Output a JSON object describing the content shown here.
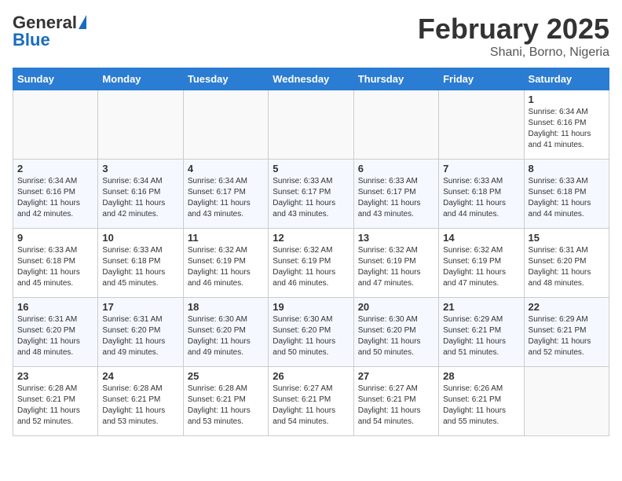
{
  "header": {
    "logo_general": "General",
    "logo_blue": "Blue",
    "title": "February 2025",
    "subtitle": "Shani, Borno, Nigeria"
  },
  "weekdays": [
    "Sunday",
    "Monday",
    "Tuesday",
    "Wednesday",
    "Thursday",
    "Friday",
    "Saturday"
  ],
  "weeks": [
    [
      {
        "day": "",
        "info": ""
      },
      {
        "day": "",
        "info": ""
      },
      {
        "day": "",
        "info": ""
      },
      {
        "day": "",
        "info": ""
      },
      {
        "day": "",
        "info": ""
      },
      {
        "day": "",
        "info": ""
      },
      {
        "day": "1",
        "info": "Sunrise: 6:34 AM\nSunset: 6:16 PM\nDaylight: 11 hours and 41 minutes."
      }
    ],
    [
      {
        "day": "2",
        "info": "Sunrise: 6:34 AM\nSunset: 6:16 PM\nDaylight: 11 hours and 42 minutes."
      },
      {
        "day": "3",
        "info": "Sunrise: 6:34 AM\nSunset: 6:16 PM\nDaylight: 11 hours and 42 minutes."
      },
      {
        "day": "4",
        "info": "Sunrise: 6:34 AM\nSunset: 6:17 PM\nDaylight: 11 hours and 43 minutes."
      },
      {
        "day": "5",
        "info": "Sunrise: 6:33 AM\nSunset: 6:17 PM\nDaylight: 11 hours and 43 minutes."
      },
      {
        "day": "6",
        "info": "Sunrise: 6:33 AM\nSunset: 6:17 PM\nDaylight: 11 hours and 43 minutes."
      },
      {
        "day": "7",
        "info": "Sunrise: 6:33 AM\nSunset: 6:18 PM\nDaylight: 11 hours and 44 minutes."
      },
      {
        "day": "8",
        "info": "Sunrise: 6:33 AM\nSunset: 6:18 PM\nDaylight: 11 hours and 44 minutes."
      }
    ],
    [
      {
        "day": "9",
        "info": "Sunrise: 6:33 AM\nSunset: 6:18 PM\nDaylight: 11 hours and 45 minutes."
      },
      {
        "day": "10",
        "info": "Sunrise: 6:33 AM\nSunset: 6:18 PM\nDaylight: 11 hours and 45 minutes."
      },
      {
        "day": "11",
        "info": "Sunrise: 6:32 AM\nSunset: 6:19 PM\nDaylight: 11 hours and 46 minutes."
      },
      {
        "day": "12",
        "info": "Sunrise: 6:32 AM\nSunset: 6:19 PM\nDaylight: 11 hours and 46 minutes."
      },
      {
        "day": "13",
        "info": "Sunrise: 6:32 AM\nSunset: 6:19 PM\nDaylight: 11 hours and 47 minutes."
      },
      {
        "day": "14",
        "info": "Sunrise: 6:32 AM\nSunset: 6:19 PM\nDaylight: 11 hours and 47 minutes."
      },
      {
        "day": "15",
        "info": "Sunrise: 6:31 AM\nSunset: 6:20 PM\nDaylight: 11 hours and 48 minutes."
      }
    ],
    [
      {
        "day": "16",
        "info": "Sunrise: 6:31 AM\nSunset: 6:20 PM\nDaylight: 11 hours and 48 minutes."
      },
      {
        "day": "17",
        "info": "Sunrise: 6:31 AM\nSunset: 6:20 PM\nDaylight: 11 hours and 49 minutes."
      },
      {
        "day": "18",
        "info": "Sunrise: 6:30 AM\nSunset: 6:20 PM\nDaylight: 11 hours and 49 minutes."
      },
      {
        "day": "19",
        "info": "Sunrise: 6:30 AM\nSunset: 6:20 PM\nDaylight: 11 hours and 50 minutes."
      },
      {
        "day": "20",
        "info": "Sunrise: 6:30 AM\nSunset: 6:20 PM\nDaylight: 11 hours and 50 minutes."
      },
      {
        "day": "21",
        "info": "Sunrise: 6:29 AM\nSunset: 6:21 PM\nDaylight: 11 hours and 51 minutes."
      },
      {
        "day": "22",
        "info": "Sunrise: 6:29 AM\nSunset: 6:21 PM\nDaylight: 11 hours and 52 minutes."
      }
    ],
    [
      {
        "day": "23",
        "info": "Sunrise: 6:28 AM\nSunset: 6:21 PM\nDaylight: 11 hours and 52 minutes."
      },
      {
        "day": "24",
        "info": "Sunrise: 6:28 AM\nSunset: 6:21 PM\nDaylight: 11 hours and 53 minutes."
      },
      {
        "day": "25",
        "info": "Sunrise: 6:28 AM\nSunset: 6:21 PM\nDaylight: 11 hours and 53 minutes."
      },
      {
        "day": "26",
        "info": "Sunrise: 6:27 AM\nSunset: 6:21 PM\nDaylight: 11 hours and 54 minutes."
      },
      {
        "day": "27",
        "info": "Sunrise: 6:27 AM\nSunset: 6:21 PM\nDaylight: 11 hours and 54 minutes."
      },
      {
        "day": "28",
        "info": "Sunrise: 6:26 AM\nSunset: 6:21 PM\nDaylight: 11 hours and 55 minutes."
      },
      {
        "day": "",
        "info": ""
      }
    ]
  ]
}
